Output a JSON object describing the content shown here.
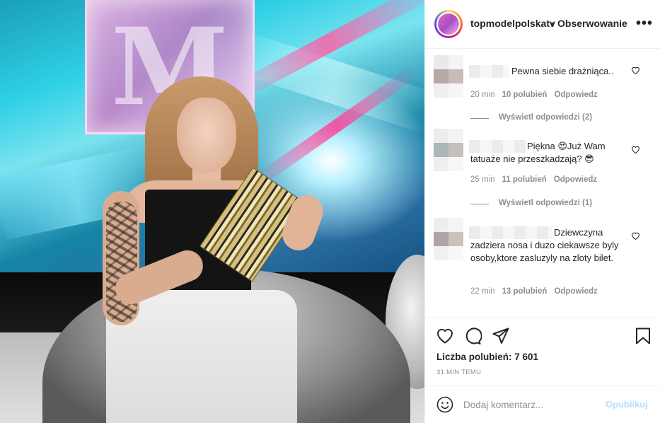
{
  "post": {
    "username": "topmodelpolskatv",
    "separator": "•",
    "follow_label": "Obserwowanie",
    "more_label": "•••"
  },
  "comments": [
    {
      "text": "Pewna siebie drażniąca..",
      "time": "20 min",
      "likes": "10 polubień",
      "reply_label": "Odpowiedz",
      "view_replies": "Wyświetl odpowiedzi (2)"
    },
    {
      "text": "Piękna 😍Już Wam tatuaże nie przeszkadzają? 😎",
      "time": "25 min",
      "likes": "11 polubień",
      "reply_label": "Odpowiedz",
      "view_replies": "Wyświetl odpowiedzi (1)"
    },
    {
      "text": "Dziewczyna zadziera nosa i duzo ciekawsze byly osoby,ktore zasluzyly na zloty bilet.",
      "time": "22 min",
      "likes": "13 polubień",
      "reply_label": "Odpowiedz"
    }
  ],
  "actions": {
    "likes_text": "Liczba polubień: 7 601",
    "time_ago": "31 MIN TEMU"
  },
  "add_comment": {
    "placeholder": "Dodaj komentarz...",
    "post_label": "Opublikuj"
  },
  "colors": {
    "text": "#262626",
    "secondary": "#8e8e8e",
    "link_disabled": "#b2dffc",
    "border": "#efefef"
  },
  "icons": [
    "heart-icon",
    "comment-icon",
    "share-icon",
    "bookmark-icon",
    "emoji-icon",
    "more-icon"
  ]
}
